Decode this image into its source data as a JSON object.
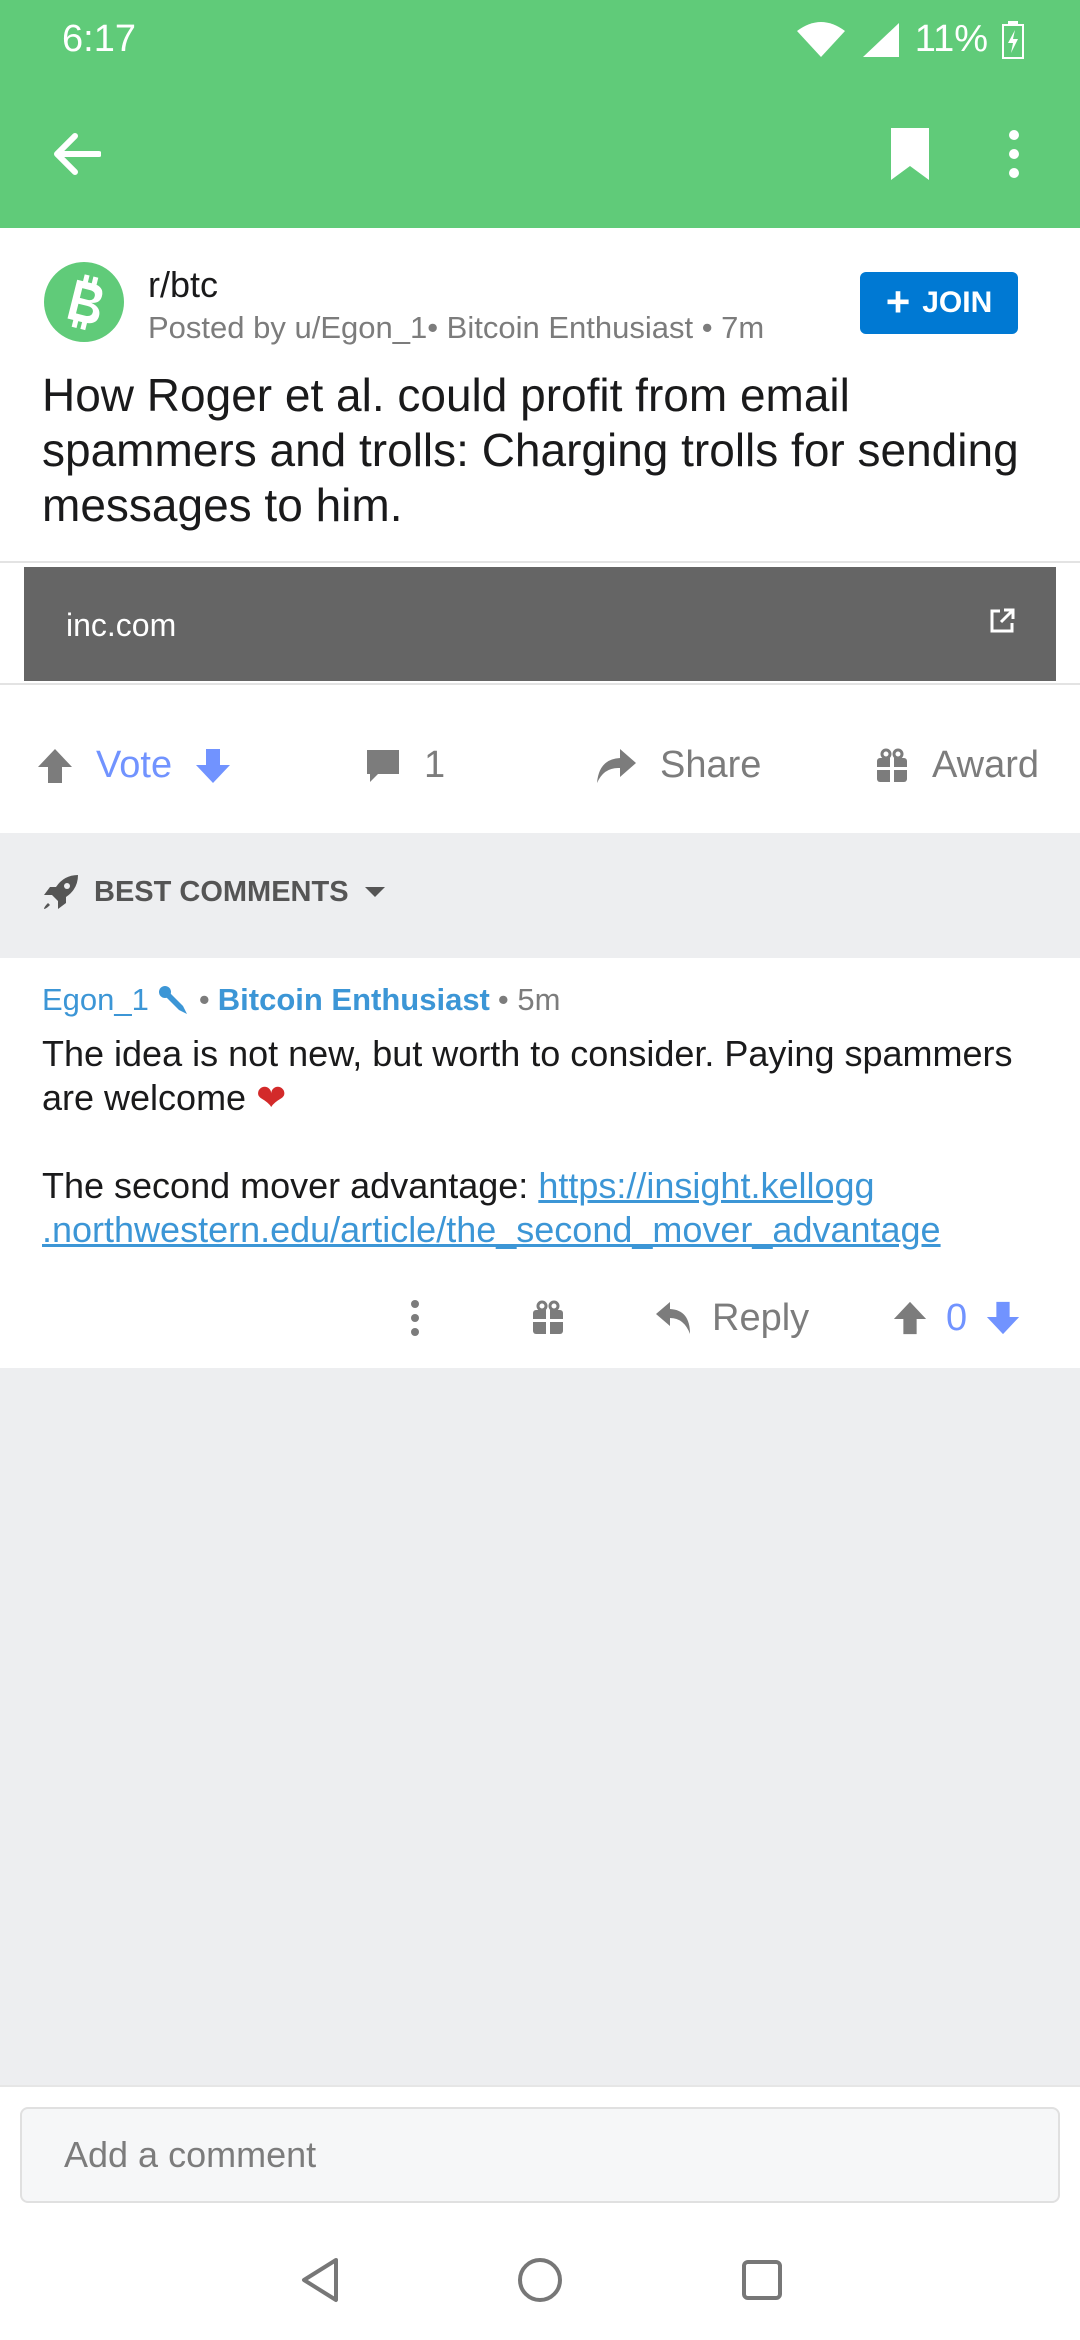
{
  "status_bar": {
    "time": "6:17",
    "battery": "11%"
  },
  "toolbar": {
    "back_icon": "arrow-left-icon",
    "bookmark_icon": "bookmark-icon",
    "more_icon": "more-vertical-icon"
  },
  "post": {
    "subreddit": "r/btc",
    "meta": "Posted by u/Egon_1• Bitcoin Enthusiast • 7m",
    "join_label": "JOIN",
    "title": "How Roger et al. could profit from email spammers and trolls: Charging trolls for sending messages to him.",
    "link_domain": "inc.com",
    "vote_label": "Vote",
    "comment_count": "1",
    "share_label": "Share",
    "award_label": "Award"
  },
  "comments_header": {
    "sort_label": "BEST COMMENTS"
  },
  "comment": {
    "author": "Egon_1",
    "separator": "•",
    "flair": "Bitcoin Enthusiast",
    "time": "• 5m",
    "body_line1": "The idea is not new, but worth to consider. Paying spammers are welcome",
    "body_line2_prefix": "The second mover advantage:",
    "link_part1": "https://insight.kellogg",
    "link_part2": ".northwestern.edu/article/the_second_mover_advantage",
    "reply_label": "Reply",
    "score": "0"
  },
  "comment_input": {
    "placeholder": "Add a comment"
  },
  "colors": {
    "app_bar": "#60cb79",
    "join": "#0079d3",
    "upvote": "#7193ff",
    "link": "#3c96d6"
  }
}
